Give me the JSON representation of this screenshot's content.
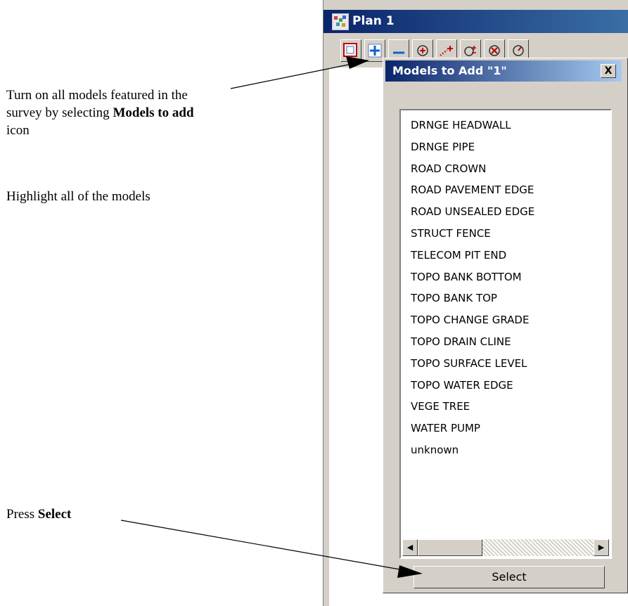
{
  "annotations": {
    "note1_line1": "Turn on all models featured in the",
    "note1_line2_prefix": "survey by selecting ",
    "note1_line2_bold": "Models to add",
    "note1_line3": "icon",
    "note2": "Highlight all of the models",
    "note3_prefix": "Press ",
    "note3_bold": "Select"
  },
  "plan_window": {
    "title": "Plan 1",
    "toolbar_icons": [
      "display-icon",
      "add-models-icon",
      "remove-models-icon",
      "zoom-icon",
      "add-line-icon",
      "zoom-plus-minus-icon",
      "zoom-fit-icon",
      "rotate-icon"
    ]
  },
  "dialog": {
    "title": "Models to Add \"1\"",
    "close_label": "X",
    "models": [
      "DRNGE HEADWALL",
      "DRNGE PIPE",
      "ROAD CROWN",
      "ROAD PAVEMENT EDGE",
      "ROAD UNSEALED EDGE",
      "STRUCT FENCE",
      "TELECOM PIT END",
      "TOPO BANK BOTTOM",
      "TOPO BANK TOP",
      "TOPO CHANGE GRADE",
      "TOPO DRAIN CLINE",
      "TOPO SURFACE LEVEL",
      "TOPO WATER EDGE",
      "VEGE TREE",
      "WATER PUMP",
      "unknown"
    ],
    "select_label": "Select"
  },
  "colors": {
    "titlebar_start": "#0a246a",
    "window_face": "#d4d0c8"
  }
}
